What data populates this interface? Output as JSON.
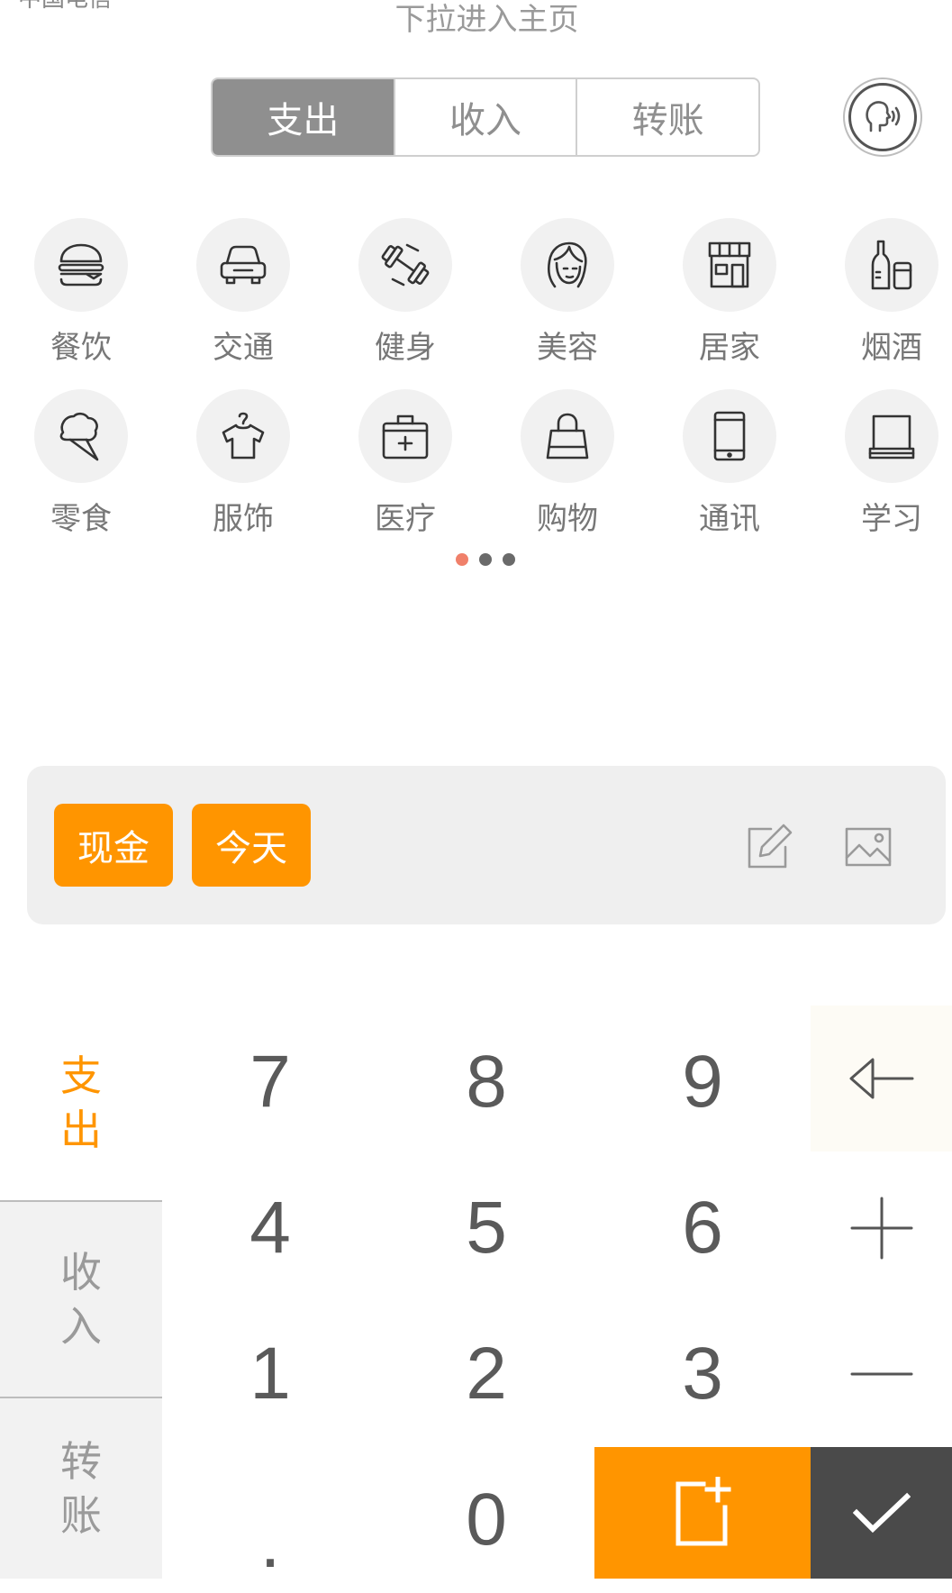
{
  "status_bar": {
    "carrier": "中国电信"
  },
  "header": {
    "pull_hint": "下拉进入主页"
  },
  "tabs": [
    {
      "label": "支出",
      "active": true
    },
    {
      "label": "收入",
      "active": false
    },
    {
      "label": "转账",
      "active": false
    }
  ],
  "voice": {
    "icon": "voice-speak-icon"
  },
  "categories": [
    {
      "label": "餐饮",
      "icon": "burger-icon"
    },
    {
      "label": "交通",
      "icon": "car-icon"
    },
    {
      "label": "健身",
      "icon": "dumbbell-icon"
    },
    {
      "label": "美容",
      "icon": "woman-face-icon"
    },
    {
      "label": "居家",
      "icon": "house-store-icon"
    },
    {
      "label": "烟酒",
      "icon": "bottle-icon"
    },
    {
      "label": "零食",
      "icon": "ice-cream-icon"
    },
    {
      "label": "服饰",
      "icon": "shirt-hanger-icon"
    },
    {
      "label": "医疗",
      "icon": "medical-kit-icon"
    },
    {
      "label": "购物",
      "icon": "shopping-bag-icon"
    },
    {
      "label": "通讯",
      "icon": "phone-icon"
    },
    {
      "label": "学习",
      "icon": "book-icon"
    }
  ],
  "pager": {
    "pages": 3,
    "current": 1
  },
  "entry": {
    "account_chip": "现金",
    "date_chip": "今天",
    "note_icon": "edit-note-icon",
    "photo_icon": "image-icon"
  },
  "keypad": {
    "side_tabs": {
      "expense": [
        "支",
        "出"
      ],
      "income": [
        "收",
        "入"
      ],
      "transfer": [
        "转",
        "账"
      ]
    },
    "keys": {
      "k7": "7",
      "k8": "8",
      "k9": "9",
      "k4": "4",
      "k5": "5",
      "k6": "6",
      "k1": "1",
      "k2": "2",
      "k3": "3",
      "dot": ".",
      "k0": "0"
    },
    "icons": {
      "backspace": "backspace-arrow-icon",
      "plus": "plus-icon",
      "minus": "minus-icon",
      "save_again": "add-another-icon",
      "confirm": "checkmark-icon"
    }
  },
  "colors": {
    "accent": "#ff9500",
    "tab_active": "#8f8f8f",
    "confirm_bg": "#4a4a4a",
    "pager_active": "#f0806a"
  }
}
